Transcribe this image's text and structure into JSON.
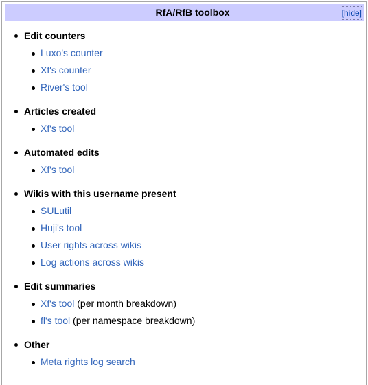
{
  "toolbox": {
    "title": "RfA/RfB toolbox",
    "hide_label": "[hide]"
  },
  "sections": [
    {
      "heading": "Edit counters",
      "items": [
        {
          "link": "Luxo's counter"
        },
        {
          "link": "Xf's counter"
        },
        {
          "link": "River's tool"
        }
      ]
    },
    {
      "heading": "Articles created",
      "items": [
        {
          "link": "Xf's tool"
        }
      ]
    },
    {
      "heading": "Automated edits",
      "items": [
        {
          "link": "Xf's tool"
        }
      ]
    },
    {
      "heading": "Wikis with this username present",
      "items": [
        {
          "link": "SULutil"
        },
        {
          "link": "Huji's tool"
        },
        {
          "link": "User rights across wikis"
        },
        {
          "link": "Log actions across wikis"
        }
      ]
    },
    {
      "heading": "Edit summaries",
      "items": [
        {
          "link": "Xf's tool",
          "note": " (per month breakdown)"
        },
        {
          "link": "fl's tool",
          "note": " (per namespace breakdown)"
        }
      ]
    },
    {
      "heading": "Other",
      "items": [
        {
          "link": "Meta rights log search"
        }
      ]
    }
  ]
}
